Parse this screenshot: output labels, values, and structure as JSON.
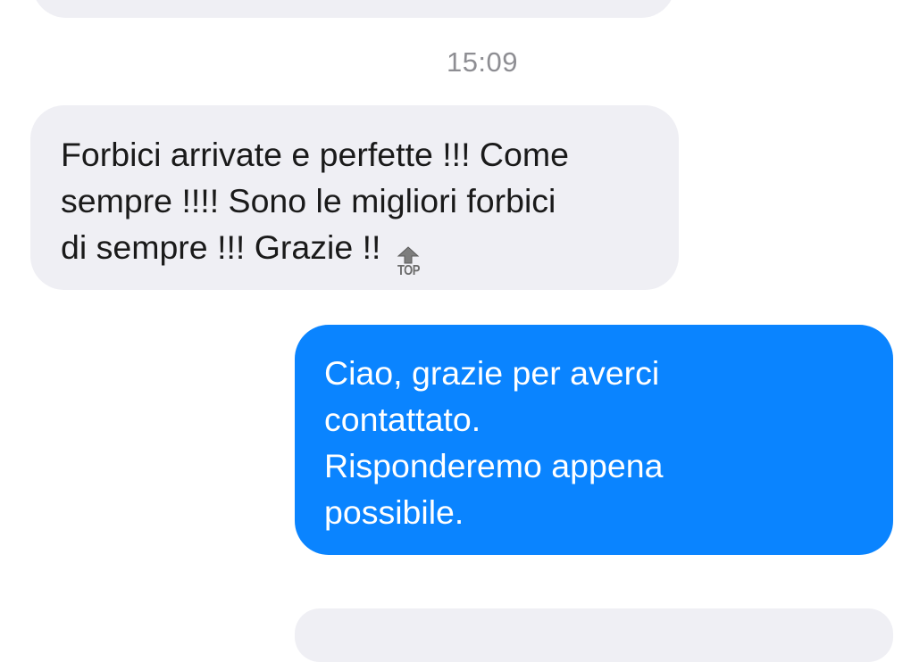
{
  "conversation": {
    "timestamp": "15:09",
    "incoming_message": {
      "text": "Forbici arrivate e perfette !!! Come\nsempre !!!! Sono le migliori forbici\ndi sempre !!! Grazie !!",
      "emoji_label": "TOP",
      "emoji_icon": "top-arrow-icon"
    },
    "outgoing_message": {
      "text": "Ciao, grazie per averci\ncontattato.\nRisponderemo appena\npossibile."
    },
    "colors": {
      "incoming_bubble": "#efeff4",
      "outgoing_bubble": "#0a84ff",
      "timestamp": "#8e8e93"
    }
  }
}
